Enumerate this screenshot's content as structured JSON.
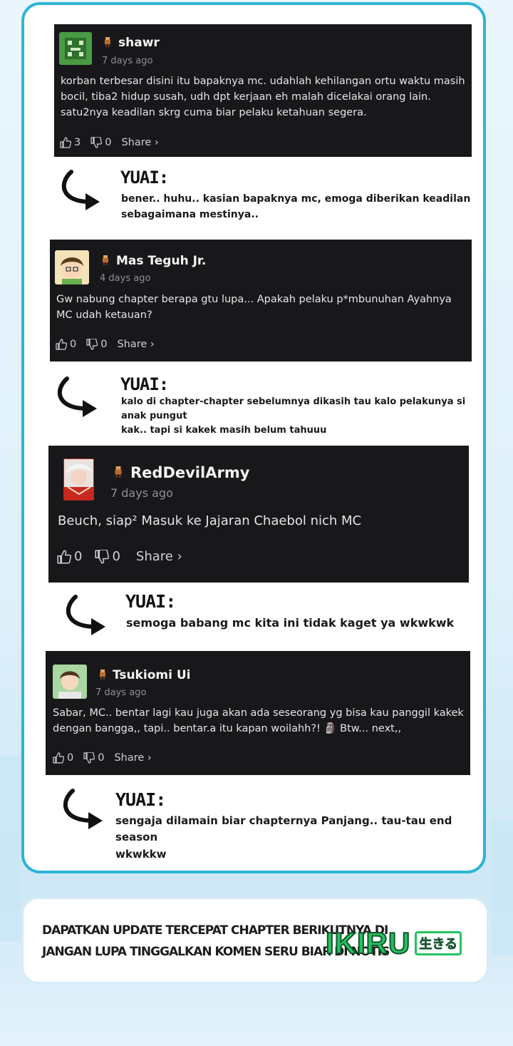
{
  "comments": [
    {
      "username": "shawr",
      "time": "7 days ago",
      "text_lines": [
        "korban terbesar disini itu bapaknya mc. udahlah kehilangan ortu waktu masih",
        "bocil, tiba2 hidup susah, udh dpt kerjaan eh malah dicelakai orang lain.",
        "satu2nya keadilan skrg cuma biar pelaku ketahuan segera."
      ],
      "likes": "3",
      "dislikes": "0",
      "share_label": "Share ›"
    },
    {
      "username": "Mas Teguh Jr.",
      "time": "4 days ago",
      "text_lines": [
        "Gw nabung chapter berapa gtu lupa... Apakah pelaku p*mbunuhan Ayahnya",
        "MC udah ketauan?"
      ],
      "likes": "0",
      "dislikes": "0",
      "share_label": "Share ›"
    },
    {
      "username": "RedDevilArmy",
      "time": "7 days ago",
      "text_lines": [
        "Beuch, siap² Masuk ke Jajaran Chaebol nich MC"
      ],
      "likes": "0",
      "dislikes": "0",
      "share_label": "Share ›"
    },
    {
      "username": "Tsukiomi Ui",
      "time": "7 days ago",
      "text_lines": [
        "Sabar, MC.. bentar lagi kau juga akan ada seseorang yg bisa kau panggil kakek",
        "dengan bangga,, tapi.. bentar.a itu kapan woilahh?! 🗿 Btw... next,,"
      ],
      "likes": "0",
      "dislikes": "0",
      "share_label": "Share ›"
    }
  ],
  "replies": [
    {
      "name": "YUAI:",
      "lines": [
        "bener.. huhu.. kasian bapaknya mc, emoga diberikan keadilan",
        "sebagaimana mestinya.."
      ]
    },
    {
      "name": "YUAI:",
      "lines": [
        "kalo di chapter-chapter sebelumnya dikasih tau kalo pelakunya si anak pungut",
        "kak.. tapi si kakek masih belum tahuuu"
      ]
    },
    {
      "name": "YUAI:",
      "lines": [
        "semoga babang mc kita ini tidak kaget ya wkwkwk"
      ]
    },
    {
      "name": "YUAI:",
      "lines": [
        "sengaja dilamain biar chapternya Panjang.. tau-tau end season",
        "wkwkkw"
      ]
    }
  ],
  "footer": {
    "line1": "DAPATKAN UPDATE TERCEPAT CHAPTER BERIKUTNYA DI",
    "line2": "JANGAN LUPA TINGGALKAN KOMEN SERU BIAR DI NOTIS",
    "logo_text": "IKIRU",
    "logo_jp": "生きる"
  },
  "colors": {
    "panel_border": "#2db5d8",
    "card_bg": "#18181b",
    "logo_green": "#22c45e"
  },
  "icons": [
    "rank-icon",
    "thumbs-up-icon",
    "thumbs-down-icon",
    "curved-arrow-icon"
  ]
}
